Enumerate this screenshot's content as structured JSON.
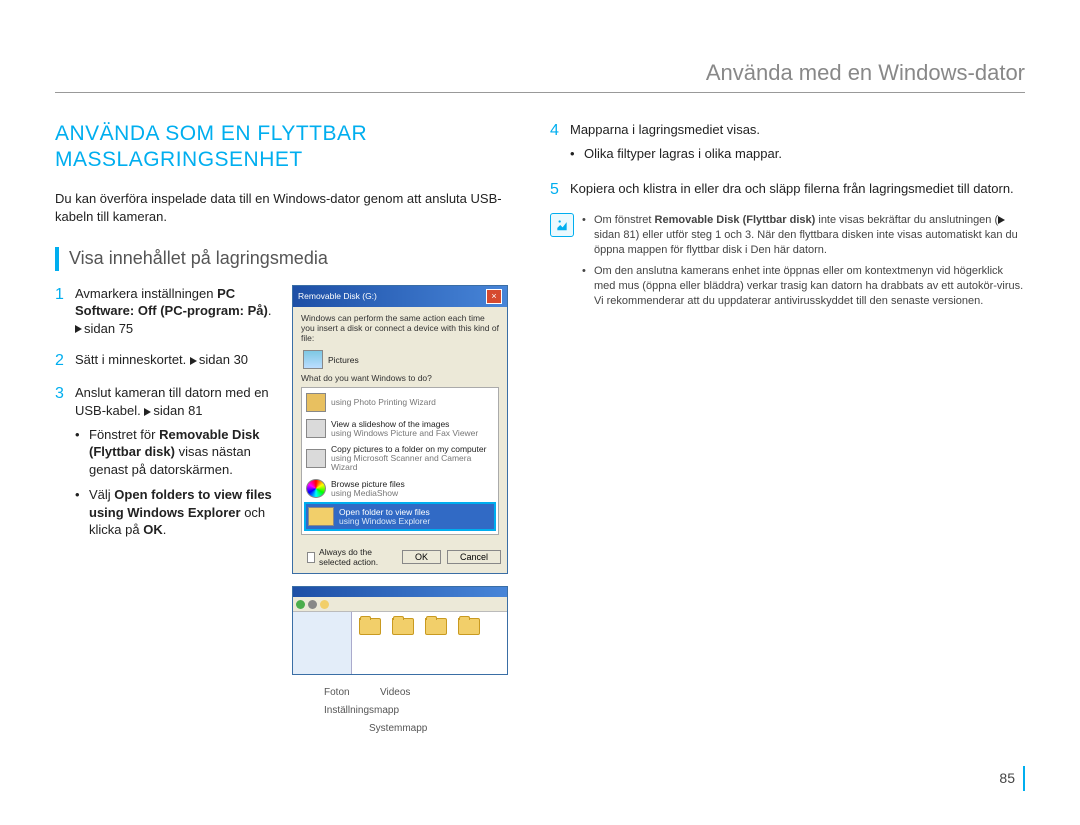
{
  "header": {
    "title": "Använda med en Windows-dator"
  },
  "section": {
    "heading": "ANVÄNDA SOM EN FLYTTBAR MASSLAGRINGSENHET",
    "intro": "Du kan överföra inspelade data till en Windows-dator genom att ansluta USB-kabeln till kameran.",
    "subheading": "Visa innehållet på lagringsmedia"
  },
  "steps_left": [
    {
      "num": "1",
      "pre": "Avmarkera inställningen ",
      "bold": "PC Software: Off (PC-program: På)",
      "post": ". ",
      "ref": "sidan 75"
    },
    {
      "num": "2",
      "pre": "Sätt i minneskortet. ",
      "ref": "sidan 30"
    },
    {
      "num": "3",
      "pre": "Anslut kameran till datorn med en USB-kabel. ",
      "ref": "sidan 81",
      "subs": [
        {
          "pre": "Fönstret för ",
          "bold": "Removable Disk (Flyttbar disk)",
          "post": " visas nästan genast på datorskärmen."
        },
        {
          "pre": "Välj ",
          "bold": "Open folders to view files using Windows Explorer",
          "post": " och klicka på ",
          "bold2": "OK",
          "post2": "."
        }
      ]
    }
  ],
  "dialog": {
    "title": "Removable Disk (G:)",
    "line1": "Windows can perform the same action each time you insert a disk or connect a device with this kind of file:",
    "pic_label": "Pictures",
    "prompt": "What do you want Windows to do?",
    "opt1_a": "using Photo Printing Wizard",
    "opt2_a": "View a slideshow of the images",
    "opt2_b": "using Windows Picture and Fax Viewer",
    "opt3_a": "Copy pictures to a folder on my computer",
    "opt3_b": "using Microsoft Scanner and Camera Wizard",
    "opt4_a": "Browse picture files",
    "opt4_b": "using MediaShow",
    "opt5_a": "Open folder to view files",
    "opt5_b": "using Windows Explorer",
    "always": "Always do the selected action.",
    "ok": "OK",
    "cancel": "Cancel"
  },
  "explorer_labels": {
    "foton": "Foton",
    "videos": "Videos",
    "installning": "Inställningsmapp",
    "system": "Systemmapp"
  },
  "steps_right": [
    {
      "num": "4",
      "text": "Mapparna i lagringsmediet visas.",
      "bullet": "Olika filtyper lagras i olika mappar."
    },
    {
      "num": "5",
      "text": "Kopiera och klistra in eller dra och släpp filerna från lagringsmediet till datorn."
    }
  ],
  "notes": [
    {
      "pre": "Om fönstret ",
      "bold": "Removable Disk (Flyttbar disk)",
      "post": " inte visas bekräftar du anslutningen (",
      "ref": "sidan 81",
      "post2": ") eller utför steg 1 och 3. När den flyttbara disken inte visas automatiskt kan du öppna mappen för flyttbar disk i Den här datorn."
    },
    {
      "text": "Om den anslutna kamerans enhet inte öppnas eller om kontextmenyn vid högerklick med mus (öppna eller bläddra) verkar trasig kan datorn ha drabbats av ett autokör-virus. Vi rekommenderar att du uppdaterar antivirusskyddet till den senaste versionen."
    }
  ],
  "page_number": "85"
}
